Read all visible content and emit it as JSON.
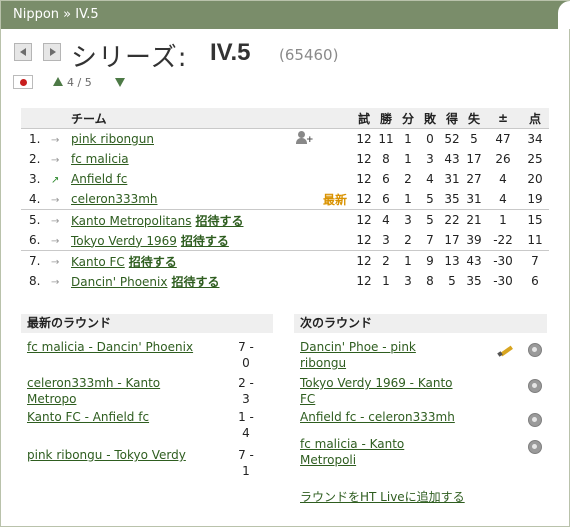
{
  "breadcrumb": "Nippon » IV.5",
  "header": {
    "series_label": "シリーズ:",
    "series_name": "IV.5",
    "series_id": "(65460)"
  },
  "level_nav": {
    "text": "4 ∕ 5"
  },
  "table": {
    "headers": [
      "チーム",
      "試",
      "勝",
      "分",
      "敗",
      "得",
      "失",
      "±",
      "点"
    ],
    "rows": [
      {
        "pos": "1.",
        "move": "same",
        "team": "pink ribongun",
        "icon": "user-add",
        "extra": "",
        "invite": "",
        "p": "12",
        "w": "11",
        "d": "1",
        "l": "0",
        "gf": "52",
        "ga": "5",
        "diff": "47",
        "pts": "34"
      },
      {
        "pos": "2.",
        "move": "same",
        "team": "fc malicia",
        "icon": "",
        "extra": "",
        "invite": "",
        "p": "12",
        "w": "8",
        "d": "1",
        "l": "3",
        "gf": "43",
        "ga": "17",
        "diff": "26",
        "pts": "25"
      },
      {
        "pos": "3.",
        "move": "up",
        "team": "Anfield fc",
        "icon": "",
        "extra": "",
        "invite": "",
        "p": "12",
        "w": "6",
        "d": "2",
        "l": "4",
        "gf": "31",
        "ga": "27",
        "diff": "4",
        "pts": "20"
      },
      {
        "pos": "4.",
        "move": "same",
        "team": "celeron333mh",
        "icon": "",
        "extra": "最新",
        "invite": "",
        "p": "12",
        "w": "6",
        "d": "1",
        "l": "5",
        "gf": "35",
        "ga": "31",
        "diff": "4",
        "pts": "19"
      },
      {
        "pos": "5.",
        "move": "same",
        "team": "Kanto Metropolitans",
        "icon": "",
        "extra": "",
        "invite": "招待する",
        "p": "12",
        "w": "4",
        "d": "3",
        "l": "5",
        "gf": "22",
        "ga": "21",
        "diff": "1",
        "pts": "15"
      },
      {
        "pos": "6.",
        "move": "same",
        "team": "Tokyo Verdy 1969",
        "icon": "",
        "extra": "",
        "invite": "招待する",
        "p": "12",
        "w": "3",
        "d": "2",
        "l": "7",
        "gf": "17",
        "ga": "39",
        "diff": "-22",
        "pts": "11"
      },
      {
        "pos": "7.",
        "move": "same",
        "team": "Kanto FC",
        "icon": "",
        "extra": "",
        "invite": "招待する",
        "p": "12",
        "w": "2",
        "d": "1",
        "l": "9",
        "gf": "13",
        "ga": "43",
        "diff": "-30",
        "pts": "7"
      },
      {
        "pos": "8.",
        "move": "same",
        "team": "Dancin' Phoenix",
        "icon": "",
        "extra": "",
        "invite": "招待する",
        "p": "12",
        "w": "1",
        "d": "3",
        "l": "8",
        "gf": "5",
        "ga": "35",
        "diff": "-30",
        "pts": "6"
      }
    ]
  },
  "latest_round": {
    "title": "最新のラウンド",
    "matches": [
      {
        "line1": "fc malicia - Dancin' Phoenix",
        "line2": "",
        "score1": "7 -",
        "score2": "0"
      },
      {
        "line1": "celeron333mh - Kanto",
        "line2": "Metropo",
        "score1": "2 -",
        "score2": "3"
      },
      {
        "line1": "Kanto FC - Anfield fc",
        "line2": "",
        "score1": "1 -",
        "score2": "4"
      },
      {
        "line1": "pink ribongu - Tokyo Verdy",
        "line2": "",
        "score1": "7 -",
        "score2": "1"
      }
    ]
  },
  "next_round": {
    "title": "次のラウンド",
    "matches": [
      {
        "line1": "Dancin' Phoe - pink",
        "line2": "ribongu"
      },
      {
        "line1": "Tokyo Verdy 1969 - Kanto",
        "line2": "FC"
      },
      {
        "line1": "Anfield fc - celeron333mh",
        "line2": ""
      },
      {
        "line1": "fc malicia - Kanto",
        "line2": "Metropoli"
      }
    ],
    "ht_live_link": "ラウンドをHT Liveに追加する"
  },
  "colors": {
    "titlebar": "#7a8d6a",
    "link": "#2e5d1f",
    "invite": "#d99200"
  }
}
